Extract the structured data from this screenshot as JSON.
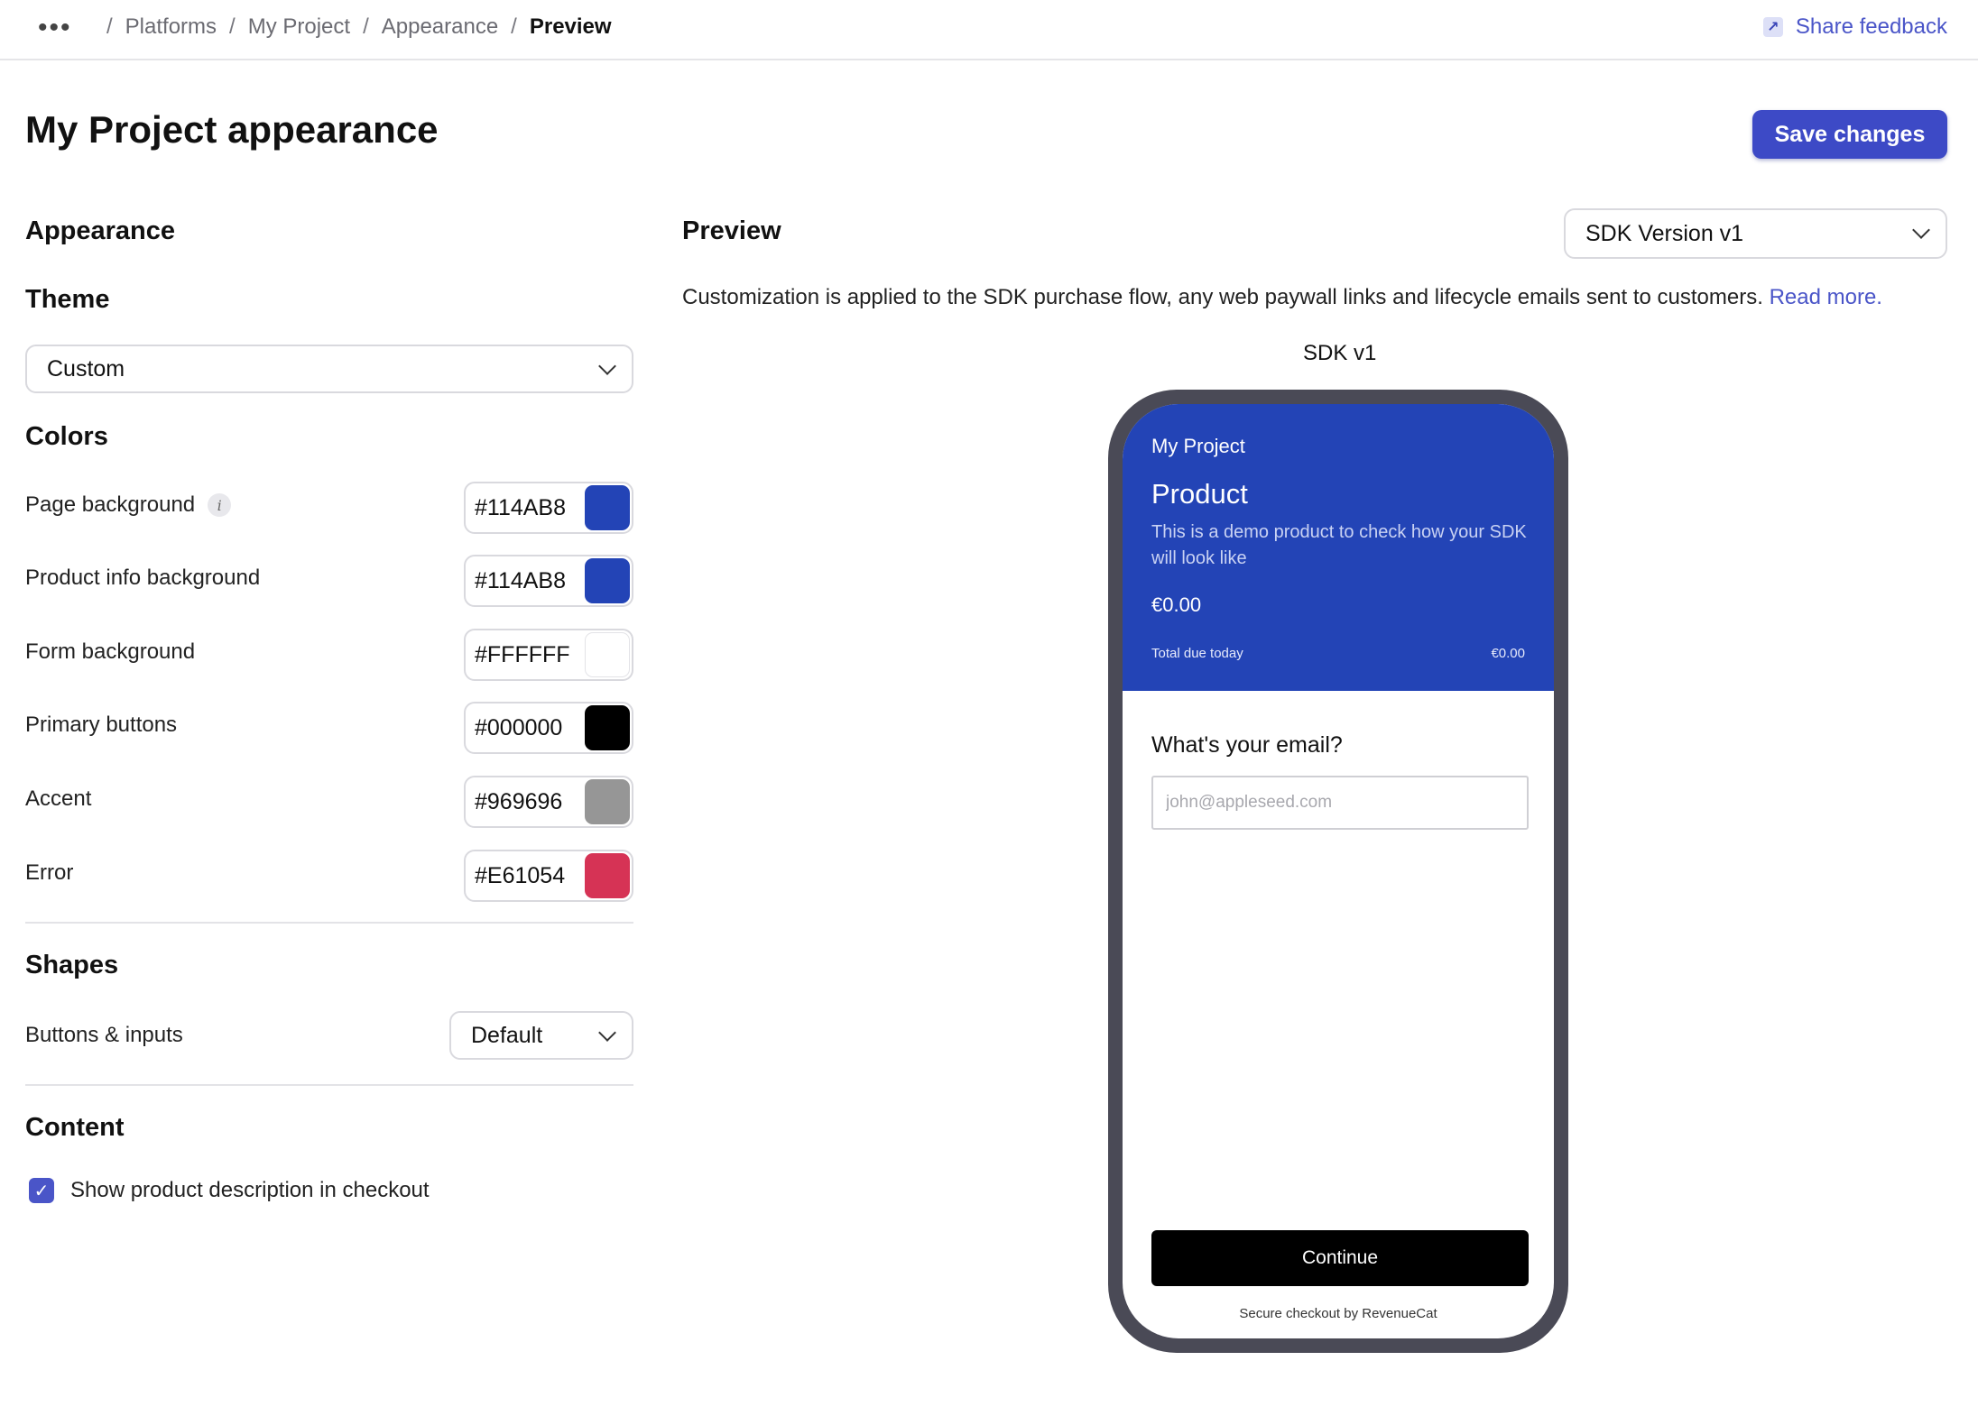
{
  "topbar": {
    "more_icon": "ellipsis-icon",
    "breadcrumbs": [
      "Platforms",
      "My Project",
      "Appearance",
      "Preview"
    ],
    "separator": "/",
    "share_feedback": "Share feedback",
    "share_icon": "external-link-icon"
  },
  "header": {
    "title": "My Project appearance",
    "save_label": "Save changes",
    "accent_color": "#3d4ac6"
  },
  "appearance": {
    "heading": "Appearance",
    "theme": {
      "heading": "Theme",
      "value": "Custom"
    },
    "colors": {
      "heading": "Colors",
      "items": [
        {
          "label": "Page background",
          "hex": "#114AB8",
          "swatch": "#2344b6"
        },
        {
          "label": "Product info background",
          "hex": "#114AB8",
          "swatch": "#2344b6"
        },
        {
          "label": "Form background",
          "hex": "#FFFFFF",
          "swatch": "#ffffff"
        },
        {
          "label": "Primary buttons",
          "hex": "#000000",
          "swatch": "#000000"
        },
        {
          "label": "Accent",
          "hex": "#969696",
          "swatch": "#969696"
        },
        {
          "label": "Error",
          "hex": "#E61054",
          "swatch": "#d63355"
        }
      ]
    },
    "shapes": {
      "heading": "Shapes",
      "buttons_inputs_label": "Buttons & inputs",
      "buttons_inputs_value": "Default"
    },
    "content": {
      "heading": "Content",
      "show_description_label": "Show product description in checkout",
      "show_description_checked": true
    }
  },
  "preview": {
    "heading": "Preview",
    "sdk_select": "SDK Version v1",
    "description": "Customization is applied to the SDK purchase flow, any web paywall links and lifecycle emails sent to customers.",
    "read_more": "Read more.",
    "sdk_label": "SDK v1",
    "phone": {
      "project": "My Project",
      "product": "Product",
      "product_description": "This is a demo product to check how your SDK will look like",
      "price": "€0.00",
      "total_label": "Total due today",
      "total_value": "€0.00",
      "email_question": "What's your email?",
      "email_placeholder": "john@appleseed.com",
      "continue_label": "Continue",
      "secure_text": "Secure checkout by RevenueCat"
    }
  }
}
